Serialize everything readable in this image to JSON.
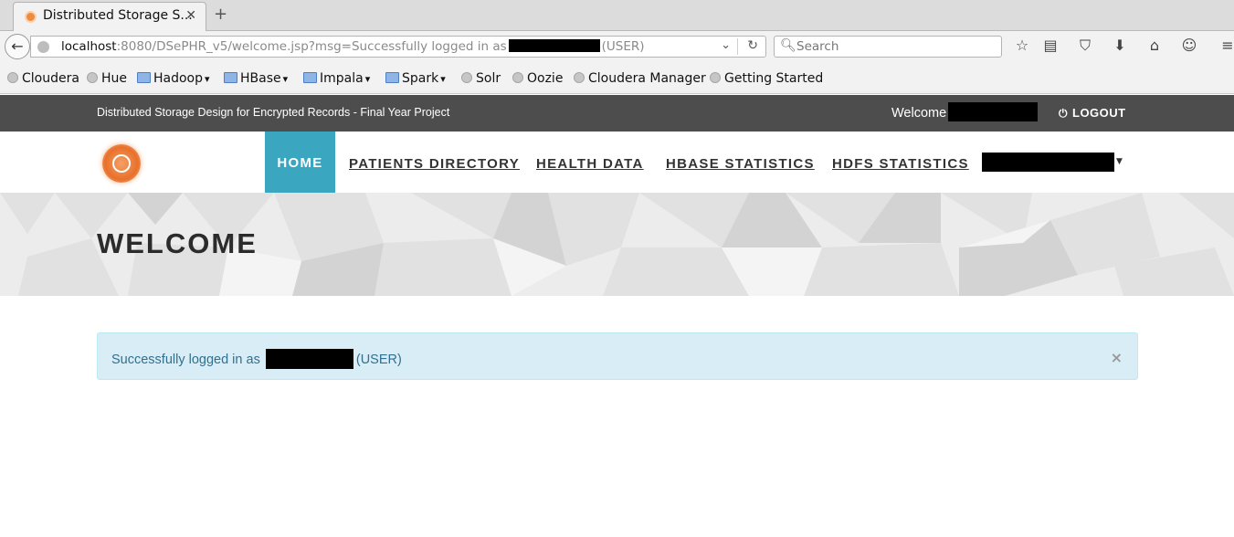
{
  "browser": {
    "tab_title": "Distributed Storage S...",
    "tab_close": "✕",
    "new_tab": "+",
    "back": "←",
    "url": {
      "host": "localhost",
      "path_before_redaction": ":8080/DSePHR_v5/welcome.jsp?msg=Successfully logged in as",
      "path_after_redaction": "(USER)",
      "dropdown": "⌄",
      "reload": "↻"
    },
    "search_placeholder": "Search",
    "toolbar_icons": [
      "star-icon",
      "reading-list-icon",
      "pocket-icon",
      "download-icon",
      "home-icon",
      "chat-icon",
      "menu-icon"
    ]
  },
  "bookmarks": [
    {
      "label": "Cloudera",
      "type": "site"
    },
    {
      "label": "Hue",
      "type": "site"
    },
    {
      "label": "Hadoop",
      "type": "folder"
    },
    {
      "label": "HBase",
      "type": "folder"
    },
    {
      "label": "Impala",
      "type": "folder"
    },
    {
      "label": "Spark",
      "type": "folder"
    },
    {
      "label": "Solr",
      "type": "site"
    },
    {
      "label": "Oozie",
      "type": "site"
    },
    {
      "label": "Cloudera Manager",
      "type": "site"
    },
    {
      "label": "Getting Started",
      "type": "site"
    }
  ],
  "site": {
    "project_title": "Distributed Storage Design for Encrypted Records - Final Year Project",
    "welcome_label": "Welcome",
    "logout_label": "LOGOUT",
    "nav": {
      "home": "HOME",
      "patients_directory": "PATIENTS DIRECTORY",
      "health_data": "HEALTH DATA",
      "hbase_statistics": "HBASE STATISTICS",
      "hdfs_statistics": "HDFS STATISTICS"
    },
    "hero_title": "WELCOME",
    "alert": {
      "text_before": "Successfully logged in as",
      "text_after": "(USER)",
      "close": "×"
    },
    "colors": {
      "accent": "#3aa6c0",
      "top_strip": "#4d4d4d",
      "alert_bg": "#d9edf7",
      "alert_text": "#31708f"
    }
  }
}
